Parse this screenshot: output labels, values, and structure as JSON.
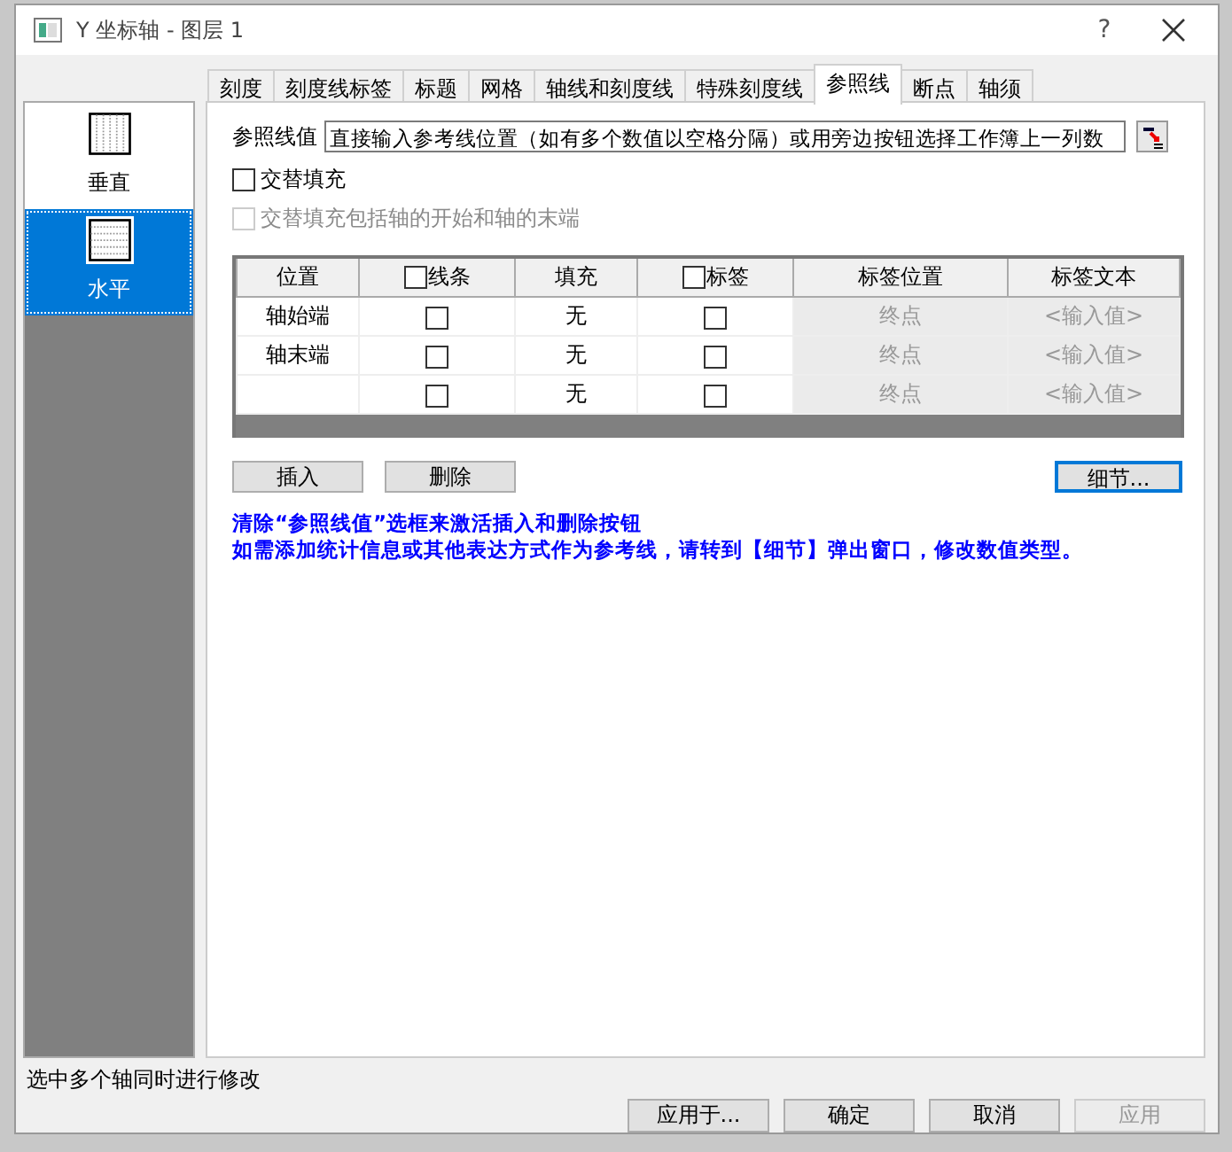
{
  "window": {
    "title": "Y 坐标轴 - 图层 1",
    "help": "?"
  },
  "tabs": [
    {
      "label": "刻度",
      "selected": false
    },
    {
      "label": "刻度线标签",
      "selected": false
    },
    {
      "label": "标题",
      "selected": false
    },
    {
      "label": "网格",
      "selected": false
    },
    {
      "label": "轴线和刻度线",
      "selected": false
    },
    {
      "label": "特殊刻度线",
      "selected": false
    },
    {
      "label": "参照线",
      "selected": true
    },
    {
      "label": "断点",
      "selected": false
    },
    {
      "label": "轴须",
      "selected": false
    }
  ],
  "sidebar": {
    "items": [
      {
        "label": "垂直",
        "kind": "vertical",
        "selected": false
      },
      {
        "label": "水平",
        "kind": "horizontal",
        "selected": true
      }
    ]
  },
  "reference_value": {
    "label": "参照线值",
    "value": "直接输入参考线位置（如有多个数值以空格分隔）或用旁边按钮选择工作簿上一列数"
  },
  "options": [
    {
      "label": "交替填充",
      "checked": false,
      "disabled": false
    },
    {
      "label": "交替填充包括轴的开始和轴的末端",
      "checked": false,
      "disabled": true
    }
  ],
  "table": {
    "columns": [
      {
        "label": "位置",
        "kind": "text",
        "disabled": false
      },
      {
        "label": "线条",
        "kind": "checkbox",
        "checked": false,
        "disabled": false
      },
      {
        "label": "填充",
        "kind": "text",
        "disabled": false
      },
      {
        "label": "标签",
        "kind": "checkbox",
        "checked": false,
        "disabled": false
      },
      {
        "label": "标签位置",
        "kind": "text",
        "disabled": true
      },
      {
        "label": "标签文本",
        "kind": "text",
        "disabled": true
      }
    ],
    "rows": [
      {
        "cells": [
          {
            "text": "轴始端"
          },
          {
            "checked": false
          },
          {
            "text": "无"
          },
          {
            "checked": false
          },
          {
            "text": "终点"
          },
          {
            "text": "<输入值>"
          }
        ]
      },
      {
        "cells": [
          {
            "text": "轴末端"
          },
          {
            "checked": false
          },
          {
            "text": "无"
          },
          {
            "checked": false
          },
          {
            "text": "终点"
          },
          {
            "text": "<输入值>"
          }
        ]
      },
      {
        "cells": [
          {},
          {
            "checked": false
          },
          {
            "text": "无"
          },
          {
            "checked": false
          },
          {
            "text": "终点"
          },
          {
            "text": "<输入值>"
          }
        ]
      }
    ]
  },
  "actions": [
    {
      "label": "插入",
      "focused": false
    },
    {
      "label": "删除",
      "focused": false
    },
    {
      "label": "细节...",
      "focused": true
    }
  ],
  "notes": [
    "清除“参照线值”选框来激活插入和删除按钮",
    "如需添加统计信息或其他表达方式作为参考线，请转到【细节】弹出窗口，修改数值类型。"
  ],
  "status_bar": "选中多个轴同时进行修改",
  "buttons": [
    {
      "label": "应用于...",
      "disabled": false
    },
    {
      "label": "确定",
      "disabled": false
    },
    {
      "label": "取消",
      "disabled": false
    },
    {
      "label": "应用",
      "disabled": true
    }
  ]
}
